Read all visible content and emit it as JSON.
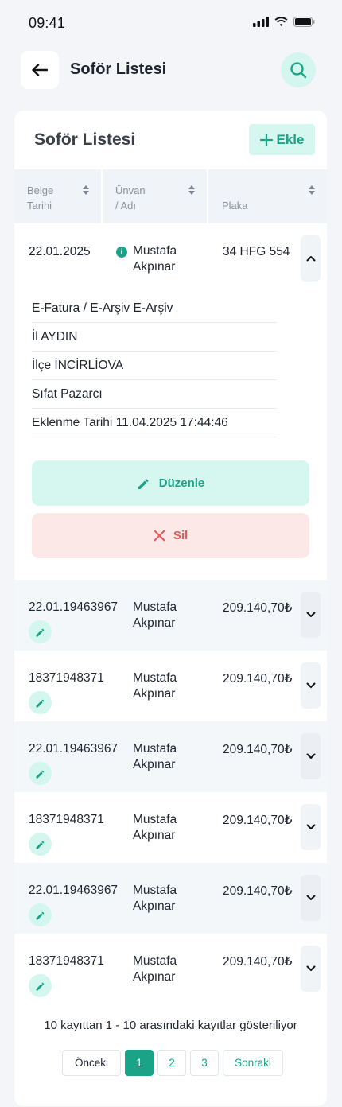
{
  "status": {
    "time": "09:41"
  },
  "header": {
    "title": "Soför Listesi"
  },
  "card": {
    "title": "Soför Listesi",
    "add_label": "Ekle"
  },
  "table": {
    "headers": {
      "date_line1": "Belge",
      "date_line2": "Tarihi",
      "name_line1": "Ünvan",
      "name_line2": "/ Adı",
      "plate": "Plaka"
    },
    "expanded": {
      "date": "22.01.2025",
      "name_line1": "Mustafa",
      "name_line2": "Akpınar",
      "plate": "34 HFG 554",
      "details": [
        "E-Fatura / E-Arşiv E-Arşiv",
        "İl AYDIN",
        "İlçe İNCİRLİOVA",
        "Sıfat Pazarcı",
        "Eklenme Tarihi 11.04.2025 17:44:46"
      ],
      "edit_label": "Düzenle",
      "delete_label": "Sil"
    },
    "rows": [
      {
        "date": "22.01.19463967",
        "name_line1": "Mustafa",
        "name_line2": "Akpınar",
        "amount": "209.140,70₺"
      },
      {
        "date": "18371948371",
        "name_line1": "Mustafa",
        "name_line2": "Akpınar",
        "amount": "209.140,70₺"
      },
      {
        "date": "22.01.19463967",
        "name_line1": "Mustafa",
        "name_line2": "Akpınar",
        "amount": "209.140,70₺"
      },
      {
        "date": "18371948371",
        "name_line1": "Mustafa",
        "name_line2": "Akpınar",
        "amount": "209.140,70₺"
      },
      {
        "date": "22.01.19463967",
        "name_line1": "Mustafa",
        "name_line2": "Akpınar",
        "amount": "209.140,70₺"
      },
      {
        "date": "18371948371",
        "name_line1": "Mustafa",
        "name_line2": "Akpınar",
        "amount": "209.140,70₺"
      }
    ]
  },
  "pagination": {
    "info": "10 kayıttan 1 - 10 arasındaki kayıtlar gösteriliyor",
    "prev": "Önceki",
    "pages": [
      "1",
      "2",
      "3"
    ],
    "next": "Sonraki",
    "current_page": 1
  },
  "colors": {
    "accent": "#1aa386",
    "accent_light": "#d5f7ef",
    "danger": "#e35a5a",
    "danger_light": "#fde8e8"
  }
}
